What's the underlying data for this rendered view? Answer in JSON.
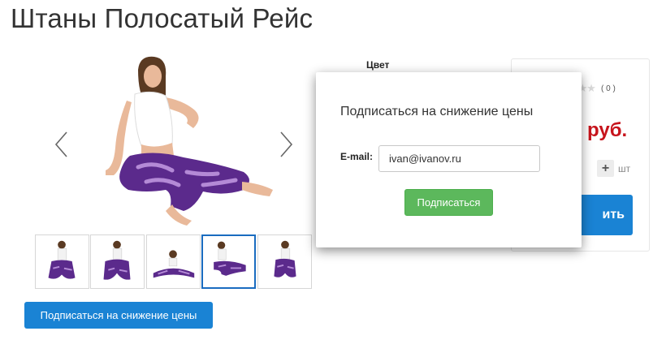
{
  "product": {
    "title": "Штаны Полосатый Рейс",
    "color_label": "Цвет"
  },
  "gallery": {
    "prev_icon": "chevron-left-icon",
    "next_icon": "chevron-right-icon",
    "thumbnail_count": 5,
    "active_thumbnail": 4
  },
  "subscribe": {
    "button_label": "Подписаться на снижение цены"
  },
  "buy_box": {
    "rating_stars": 0,
    "reviews_count": "( 0 )",
    "price_currency": "руб.",
    "qty_plus": "+",
    "qty_unit": "шт",
    "buy_label_visible": "ить"
  },
  "modal": {
    "title": "Подписаться на снижение цены",
    "email_label": "E-mail:",
    "email_value": "ivan@ivanov.ru",
    "submit_label": "Подписаться"
  },
  "colors": {
    "primary_blue": "#1a83d4",
    "price_red": "#c7141c",
    "success_green": "#5cb85c",
    "active_thumb_border": "#1a6cc0"
  }
}
